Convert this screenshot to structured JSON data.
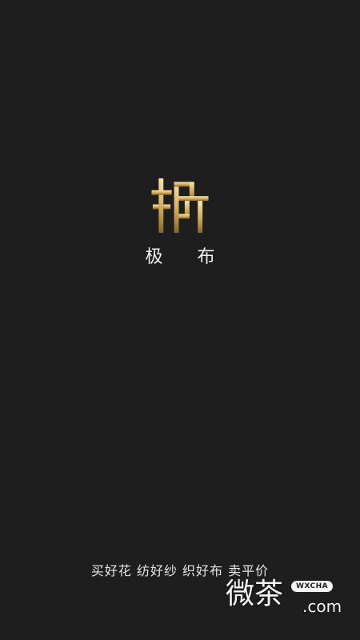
{
  "app": {
    "name": "极 布",
    "logo_icon": "jibu-logo-icon",
    "logo_colors": {
      "gold_light": "#f5dfa0",
      "gold_mid": "#d4ae5a",
      "gold_dark": "#8a6628"
    },
    "background": "#1e1e1e"
  },
  "slogan": "买好花  纺好纱  织好布  卖平价",
  "watermark": {
    "chinese": "微茶",
    "badge": "WXCHA",
    "domain": ".com"
  }
}
